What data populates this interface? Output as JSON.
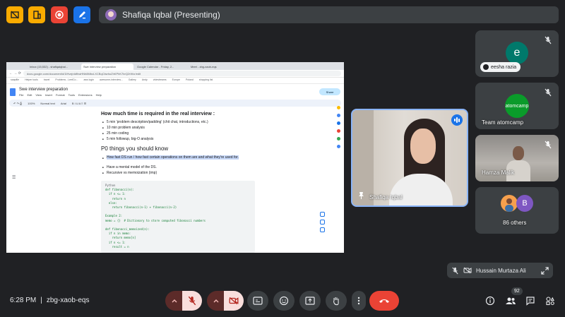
{
  "topbar": {
    "presenter_label": "Shafiqa Iqbal (Presenting)",
    "button_colors": [
      "#f9ab00",
      "#f9ab00",
      "#ea4335",
      "#1a73e8"
    ]
  },
  "screen": {
    "browser_tabs": [
      "Inbox (15,532) - shafiqaiqbal...",
      "Swe interview preparation",
      "Google Calendar - Friday, 2...",
      "Meet - zbg-xaob-eqs"
    ],
    "url": "docs.google.com/document/d/1lHvejnIdfhwHNh8MbcLXCBqCbwhoZhKPhK7brQ2rWvr/edit",
    "bookmarks": [
      "saapfile",
      "Helper tools",
      "travel",
      "Problems - LeetCo...",
      "aws login",
      "awesome-interview...",
      "Gallery",
      "Andy",
      "videstreams",
      "Europe",
      "Poland",
      "shopping list"
    ],
    "doc_title": "Swe interview preparation",
    "doc_menu": [
      "File",
      "Edit",
      "View",
      "Insert",
      "Format",
      "Tools",
      "Extensions",
      "Help"
    ],
    "share_label": "Share",
    "toolbar": {
      "zoom": "100%",
      "style": "Normal text",
      "font": "Arial"
    },
    "cut_heading": "How much time is required in the real interview :",
    "bullets_top": [
      "5 min 'problem description/padding' (chit chat, introductions, etc.)",
      "10 min problem analysis",
      "25 min coding",
      "5 min followup, big-O analysis"
    ],
    "section_heading": "P0 things you should know",
    "bullets_p0": [
      "How fast DS run / how fast certain operations on them are and what they're used for.",
      "Have a mental model of the DS.",
      "Recursive vs memoization (imp)"
    ],
    "code_caption": "Python",
    "code": "def fibonacci(n):\n  if n <= 1:\n    return n\n  else:\n    return fibonacci(n-1) + fibonacci(n-2)\n\nExample 2:\nmemo = {}  # Dictionary to store computed fibonacci numbers\n\ndef fibonacci_memoized(n):\n  if n in memo:\n    return memo[n]\n  if n <= 1:\n    result = n"
  },
  "speaker": {
    "name": "Shafiqa Iqbal"
  },
  "tiles": [
    {
      "name": "eesha razia",
      "initial": "e",
      "color": "#00796b"
    },
    {
      "name": "Team atomcamp",
      "logo_text": "atomcamp",
      "color": "#0a9b2a"
    },
    {
      "name": "Hamza Malik"
    },
    {
      "name": "86 others",
      "initial": "B",
      "color": "#7e57c2"
    }
  ],
  "hussain": {
    "name": "Hussain Murtaza Ali"
  },
  "bottom": {
    "time": "6:28 PM",
    "separator": "|",
    "meeting_code": "zbg-xaob-eqs",
    "participants_count": "92"
  }
}
